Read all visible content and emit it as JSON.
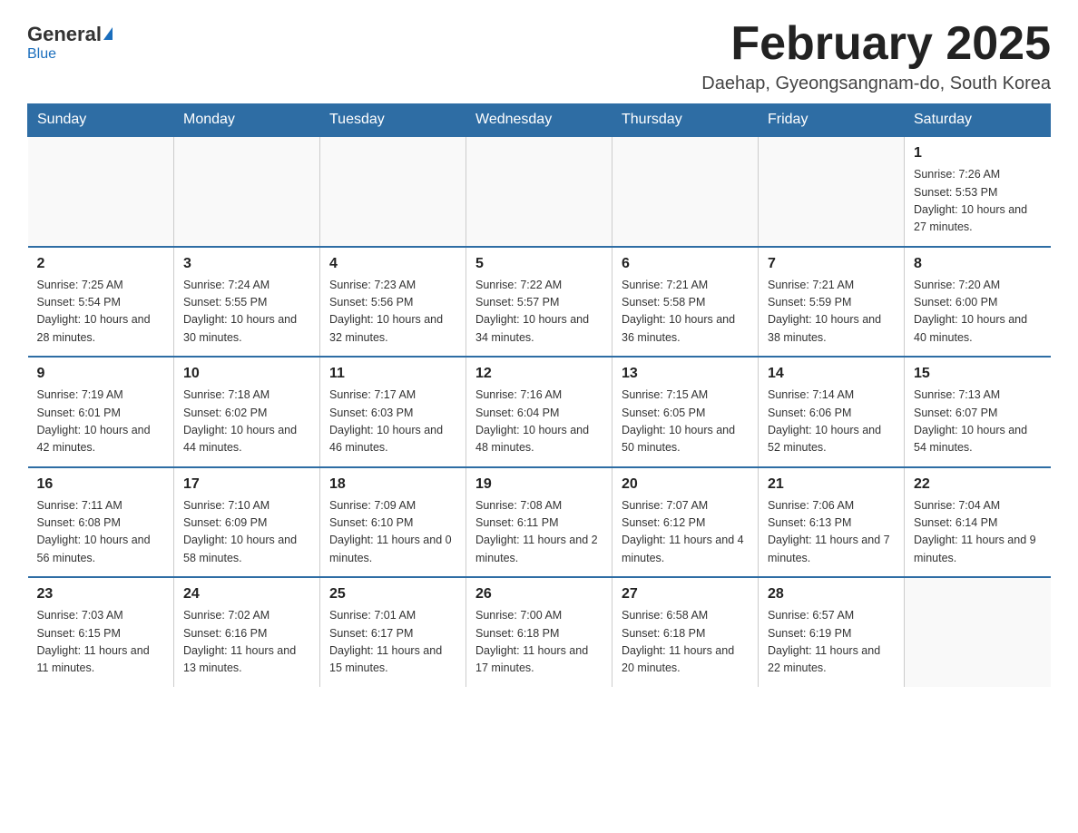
{
  "header": {
    "logo_general": "General",
    "logo_blue": "Blue",
    "title": "February 2025",
    "subtitle": "Daehap, Gyeongsangnam-do, South Korea"
  },
  "days_of_week": [
    "Sunday",
    "Monday",
    "Tuesday",
    "Wednesday",
    "Thursday",
    "Friday",
    "Saturday"
  ],
  "weeks": [
    [
      {
        "num": "",
        "info": ""
      },
      {
        "num": "",
        "info": ""
      },
      {
        "num": "",
        "info": ""
      },
      {
        "num": "",
        "info": ""
      },
      {
        "num": "",
        "info": ""
      },
      {
        "num": "",
        "info": ""
      },
      {
        "num": "1",
        "info": "Sunrise: 7:26 AM\nSunset: 5:53 PM\nDaylight: 10 hours and 27 minutes."
      }
    ],
    [
      {
        "num": "2",
        "info": "Sunrise: 7:25 AM\nSunset: 5:54 PM\nDaylight: 10 hours and 28 minutes."
      },
      {
        "num": "3",
        "info": "Sunrise: 7:24 AM\nSunset: 5:55 PM\nDaylight: 10 hours and 30 minutes."
      },
      {
        "num": "4",
        "info": "Sunrise: 7:23 AM\nSunset: 5:56 PM\nDaylight: 10 hours and 32 minutes."
      },
      {
        "num": "5",
        "info": "Sunrise: 7:22 AM\nSunset: 5:57 PM\nDaylight: 10 hours and 34 minutes."
      },
      {
        "num": "6",
        "info": "Sunrise: 7:21 AM\nSunset: 5:58 PM\nDaylight: 10 hours and 36 minutes."
      },
      {
        "num": "7",
        "info": "Sunrise: 7:21 AM\nSunset: 5:59 PM\nDaylight: 10 hours and 38 minutes."
      },
      {
        "num": "8",
        "info": "Sunrise: 7:20 AM\nSunset: 6:00 PM\nDaylight: 10 hours and 40 minutes."
      }
    ],
    [
      {
        "num": "9",
        "info": "Sunrise: 7:19 AM\nSunset: 6:01 PM\nDaylight: 10 hours and 42 minutes."
      },
      {
        "num": "10",
        "info": "Sunrise: 7:18 AM\nSunset: 6:02 PM\nDaylight: 10 hours and 44 minutes."
      },
      {
        "num": "11",
        "info": "Sunrise: 7:17 AM\nSunset: 6:03 PM\nDaylight: 10 hours and 46 minutes."
      },
      {
        "num": "12",
        "info": "Sunrise: 7:16 AM\nSunset: 6:04 PM\nDaylight: 10 hours and 48 minutes."
      },
      {
        "num": "13",
        "info": "Sunrise: 7:15 AM\nSunset: 6:05 PM\nDaylight: 10 hours and 50 minutes."
      },
      {
        "num": "14",
        "info": "Sunrise: 7:14 AM\nSunset: 6:06 PM\nDaylight: 10 hours and 52 minutes."
      },
      {
        "num": "15",
        "info": "Sunrise: 7:13 AM\nSunset: 6:07 PM\nDaylight: 10 hours and 54 minutes."
      }
    ],
    [
      {
        "num": "16",
        "info": "Sunrise: 7:11 AM\nSunset: 6:08 PM\nDaylight: 10 hours and 56 minutes."
      },
      {
        "num": "17",
        "info": "Sunrise: 7:10 AM\nSunset: 6:09 PM\nDaylight: 10 hours and 58 minutes."
      },
      {
        "num": "18",
        "info": "Sunrise: 7:09 AM\nSunset: 6:10 PM\nDaylight: 11 hours and 0 minutes."
      },
      {
        "num": "19",
        "info": "Sunrise: 7:08 AM\nSunset: 6:11 PM\nDaylight: 11 hours and 2 minutes."
      },
      {
        "num": "20",
        "info": "Sunrise: 7:07 AM\nSunset: 6:12 PM\nDaylight: 11 hours and 4 minutes."
      },
      {
        "num": "21",
        "info": "Sunrise: 7:06 AM\nSunset: 6:13 PM\nDaylight: 11 hours and 7 minutes."
      },
      {
        "num": "22",
        "info": "Sunrise: 7:04 AM\nSunset: 6:14 PM\nDaylight: 11 hours and 9 minutes."
      }
    ],
    [
      {
        "num": "23",
        "info": "Sunrise: 7:03 AM\nSunset: 6:15 PM\nDaylight: 11 hours and 11 minutes."
      },
      {
        "num": "24",
        "info": "Sunrise: 7:02 AM\nSunset: 6:16 PM\nDaylight: 11 hours and 13 minutes."
      },
      {
        "num": "25",
        "info": "Sunrise: 7:01 AM\nSunset: 6:17 PM\nDaylight: 11 hours and 15 minutes."
      },
      {
        "num": "26",
        "info": "Sunrise: 7:00 AM\nSunset: 6:18 PM\nDaylight: 11 hours and 17 minutes."
      },
      {
        "num": "27",
        "info": "Sunrise: 6:58 AM\nSunset: 6:18 PM\nDaylight: 11 hours and 20 minutes."
      },
      {
        "num": "28",
        "info": "Sunrise: 6:57 AM\nSunset: 6:19 PM\nDaylight: 11 hours and 22 minutes."
      },
      {
        "num": "",
        "info": ""
      }
    ]
  ]
}
